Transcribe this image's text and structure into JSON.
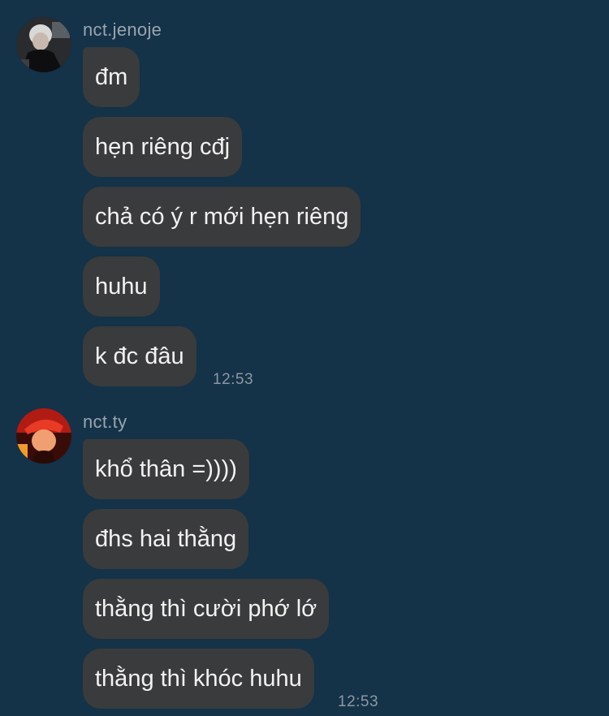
{
  "colors": {
    "background": "#143248",
    "bubble": "#3a3b3c",
    "bubble_text": "#f2f2f2",
    "username_text": "#9aa5ae",
    "timestamp_text": "#8c98a2"
  },
  "groups": [
    {
      "username": "nct.jenoje",
      "avatar": "user-avatar-icon",
      "messages": [
        "đm",
        "hẹn riêng cđj",
        "chả có ý r mới hẹn riêng",
        "huhu",
        "k đc đâu"
      ],
      "time": "12:53"
    },
    {
      "username": "nct.ty",
      "avatar": "user-avatar-icon",
      "messages": [
        "khổ thân =))))",
        "đhs hai thằng",
        "thằng thì cười phớ lớ",
        "thằng thì khóc huhu"
      ],
      "time": "12:53"
    }
  ]
}
